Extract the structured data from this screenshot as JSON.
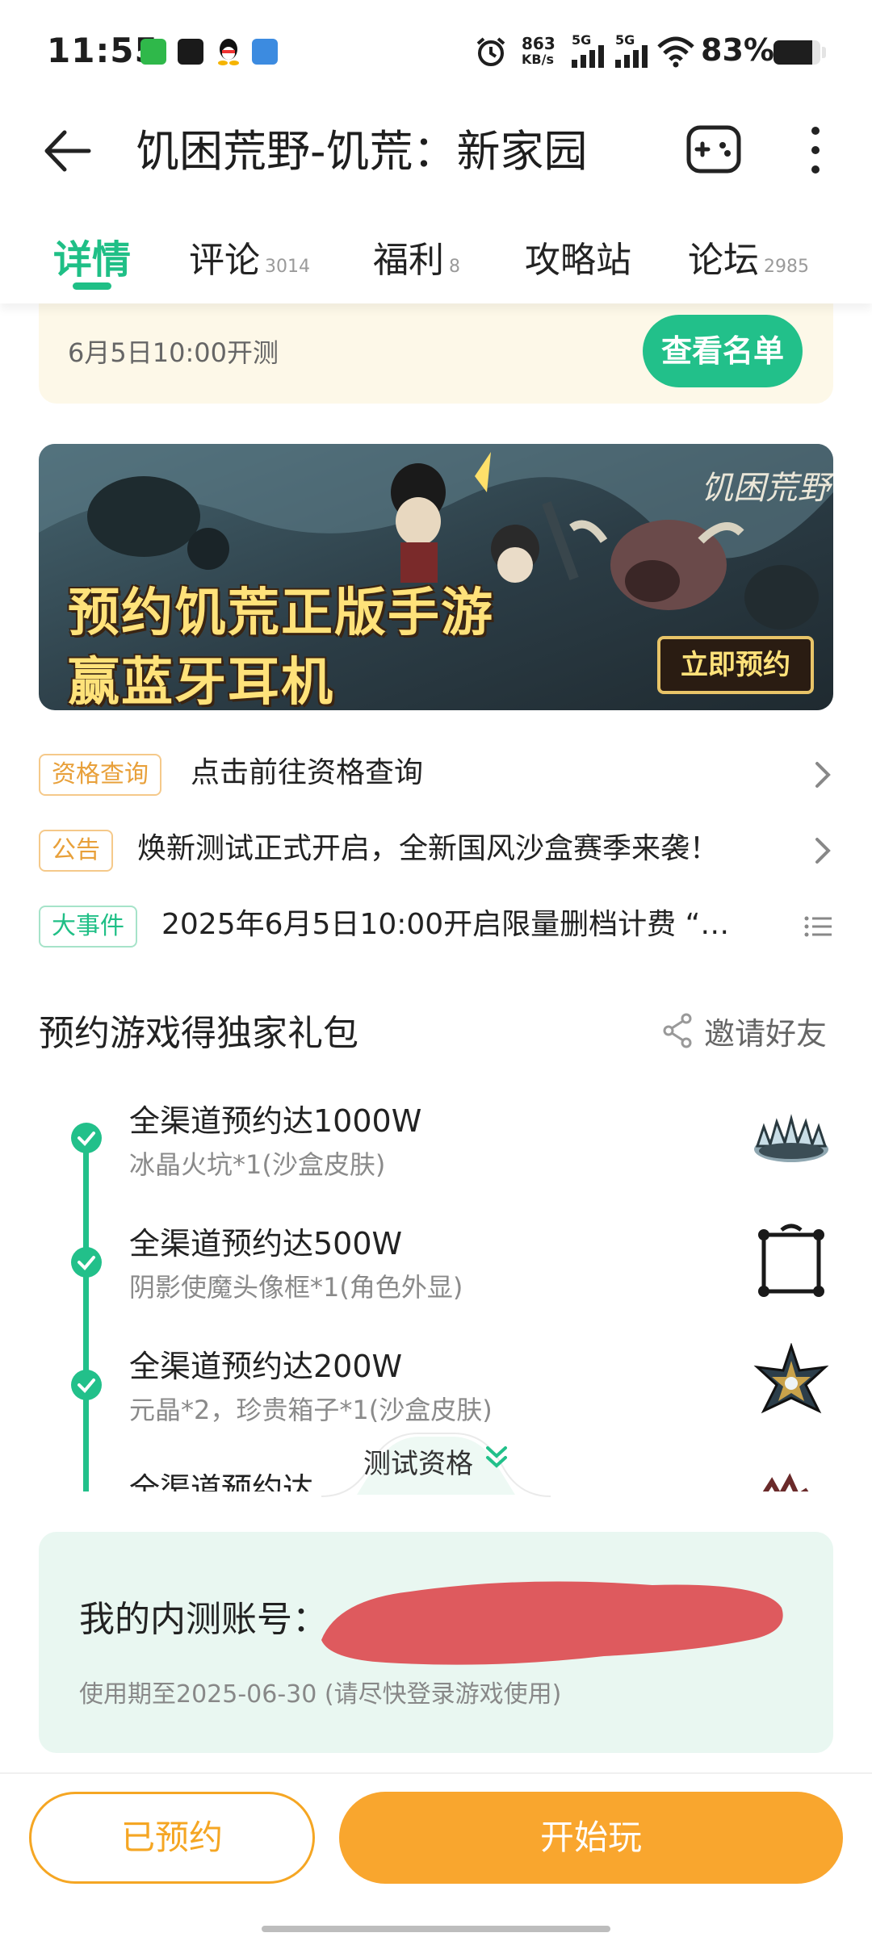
{
  "status_bar": {
    "time": "11:55",
    "net_speed": "863",
    "net_speed_unit": "KB/s",
    "signal1": "5G",
    "signal2": "5G",
    "battery": "83%",
    "battery_level": 0.83,
    "icons": [
      "app-store-icon",
      "toutiao-icon",
      "qq-icon",
      "doc-scan-icon",
      "alarm-icon",
      "wifi-icon"
    ]
  },
  "header": {
    "title": "饥困荒野-饥荒：新家园",
    "icons": [
      "back-arrow-icon",
      "gamepad-icon",
      "more-vertical-icon"
    ]
  },
  "tabs": [
    {
      "label": "详情",
      "count": ""
    },
    {
      "label": "评论",
      "count": "3014"
    },
    {
      "label": "福利",
      "count": "8"
    },
    {
      "label": "攻略站",
      "count": ""
    },
    {
      "label": "论坛",
      "count": "2985"
    }
  ],
  "test_banner": {
    "date_text": "6月5日10:00开测",
    "button": "查看名单"
  },
  "promo": {
    "line1": "预约饥荒正版手游",
    "line2": "赢蓝牙耳机",
    "logo": "饥困荒野",
    "cta": "立即预约"
  },
  "info_rows": [
    {
      "tag": "资格查询",
      "text": "点击前往资格查询"
    },
    {
      "tag": "公告",
      "text": "焕新测试正式开启，全新国风沙盒赛季来袭！"
    },
    {
      "tag": "大事件",
      "text": "2025年6月5日10:00开启限量删档计费 “…"
    }
  ],
  "gift": {
    "title": "预约游戏得独家礼包",
    "invite": "邀请好友",
    "milestones": [
      {
        "title": "全渠道预约达1000W",
        "reward": "冰晶火坑*1(沙盒皮肤)"
      },
      {
        "title": "全渠道预约达500W",
        "reward": "阴影使魔头像框*1(角色外显)"
      },
      {
        "title": "全渠道预约达200W",
        "reward": "元晶*2，珍贵箱子*1(沙盒皮肤)"
      },
      {
        "title": "全渠道预约达",
        "reward": ""
      }
    ]
  },
  "fold_handle": "测试资格",
  "account": {
    "label": "我的内测账号：",
    "expiry": "使用期至2025-06-30 (请尽快登录游戏使用)"
  },
  "bottom": {
    "reserved": "已预约",
    "play": "开始玩"
  },
  "colors": {
    "accent_green": "#1fbf86",
    "accent_orange": "#f9a62e",
    "banner_yellow": "#fdf8e8",
    "card_mint": "#e9f7f1"
  }
}
